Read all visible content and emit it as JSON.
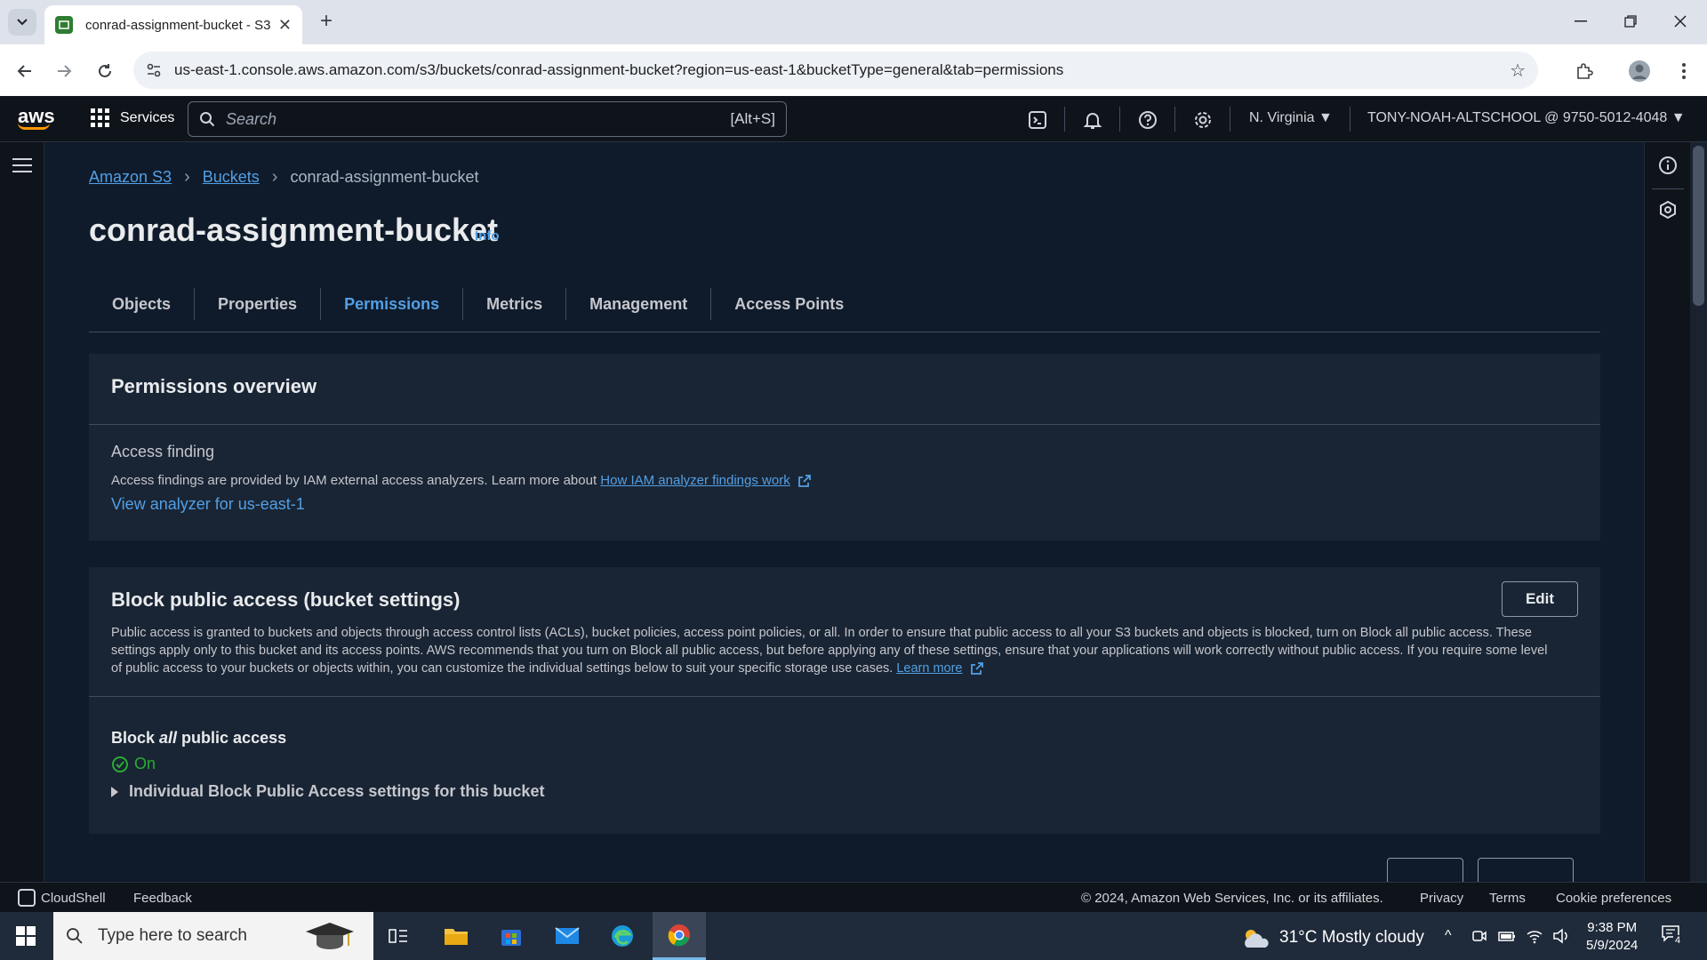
{
  "browser": {
    "tab_title": "conrad-assignment-bucket - S3",
    "url": "us-east-1.console.aws.amazon.com/s3/buckets/conrad-assignment-bucket?region=us-east-1&bucketType=general&tab=permissions"
  },
  "aws_nav": {
    "logo": "aws",
    "services_label": "Services",
    "search_placeholder": "Search",
    "search_shortcut": "[Alt+S]",
    "region": "N. Virginia ▼",
    "account": "TONY-NOAH-ALTSCHOOL @ 9750-5012-4048 ▼"
  },
  "breadcrumb": {
    "items": [
      "Amazon S3",
      "Buckets"
    ],
    "current": "conrad-assignment-bucket"
  },
  "page": {
    "title": "conrad-assignment-bucket",
    "info_link": "Info"
  },
  "tabs": [
    "Objects",
    "Properties",
    "Permissions",
    "Metrics",
    "Management",
    "Access Points"
  ],
  "active_tab": "Permissions",
  "permissions_overview": {
    "heading": "Permissions overview",
    "access_finding_label": "Access finding",
    "description": "Access findings are provided by IAM external access analyzers. Learn more about",
    "learn_link": "How IAM analyzer findings work",
    "analyzer_link": "View analyzer for us-east-1"
  },
  "block_public_access": {
    "heading": "Block public access (bucket settings)",
    "edit_label": "Edit",
    "description": "Public access is granted to buckets and objects through access control lists (ACLs), bucket policies, access point policies, or all. In order to ensure that public access to all your S3 buckets and objects is blocked, turn on Block all public access. These settings apply only to this bucket and its access points. AWS recommends that you turn on Block all public access, but before applying any of these settings, ensure that your applications will work correctly without public access. If you require some level of public access to your buckets or objects within, you can customize the individual settings below to suit your specific storage use cases.",
    "learn_more": "Learn more",
    "setting_label_pre": "Block ",
    "setting_label_em": "all",
    "setting_label_post": " public access",
    "status": "On",
    "expand_label": "Individual Block Public Access settings for this bucket"
  },
  "footer": {
    "cloudshell": "CloudShell",
    "feedback": "Feedback",
    "copyright": "© 2024, Amazon Web Services, Inc. or its affiliates.",
    "privacy": "Privacy",
    "terms": "Terms",
    "cookie": "Cookie preferences"
  },
  "taskbar": {
    "search_placeholder": "Type here to search",
    "weather": "31°C  Mostly cloudy",
    "time": "9:38 PM",
    "date": "5/9/2024",
    "notification_count": "4"
  },
  "colors": {
    "link": "#539fe5",
    "success": "#29ad32",
    "accent": "#ff9900"
  }
}
